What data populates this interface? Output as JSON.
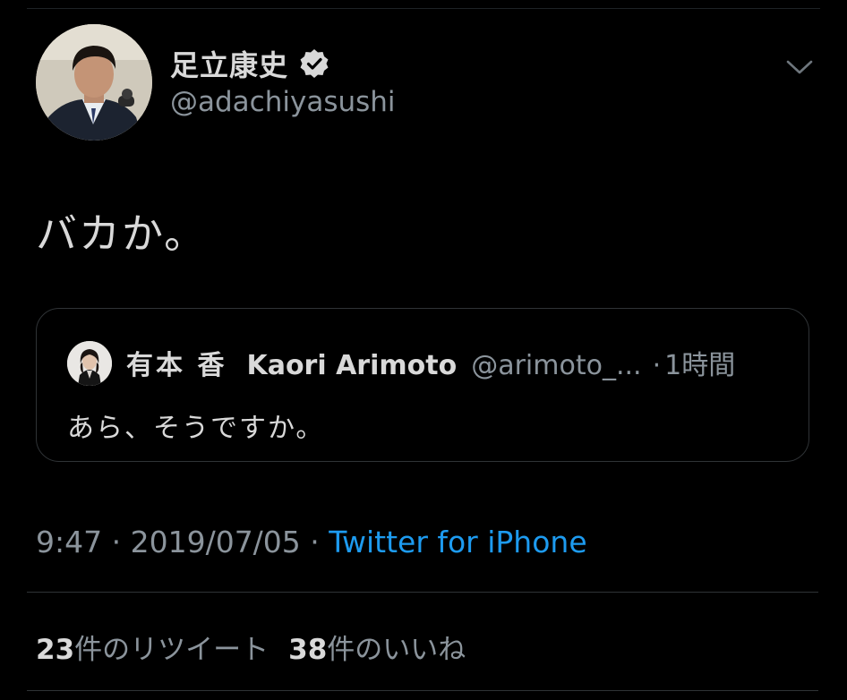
{
  "author": {
    "display_name": "足立康史",
    "handle": "@adachiyasushi"
  },
  "tweet": {
    "text": "バカか。"
  },
  "quoted_tweet": {
    "name_jp": "有本 香",
    "name_en": "Kaori Arimoto",
    "handle": "@arimoto_...",
    "separator": "·",
    "time": "1時間",
    "text": "あら、そうですか。"
  },
  "meta": {
    "time": "9:47",
    "sep1": " · ",
    "date": "2019/07/05",
    "sep2": " · ",
    "source": "Twitter for iPhone"
  },
  "stats": {
    "retweets_count": "23",
    "retweets_label": "件のリツイート",
    "likes_count": "38",
    "likes_label": "件のいいね"
  },
  "icons": {
    "verified": "verified-badge-icon",
    "menu": "chevron-down-icon"
  },
  "colors": {
    "background": "#000000",
    "text": "#d9d9d9",
    "secondary": "#8b949c",
    "link": "#1d9bf0",
    "border": "#2f3336"
  }
}
